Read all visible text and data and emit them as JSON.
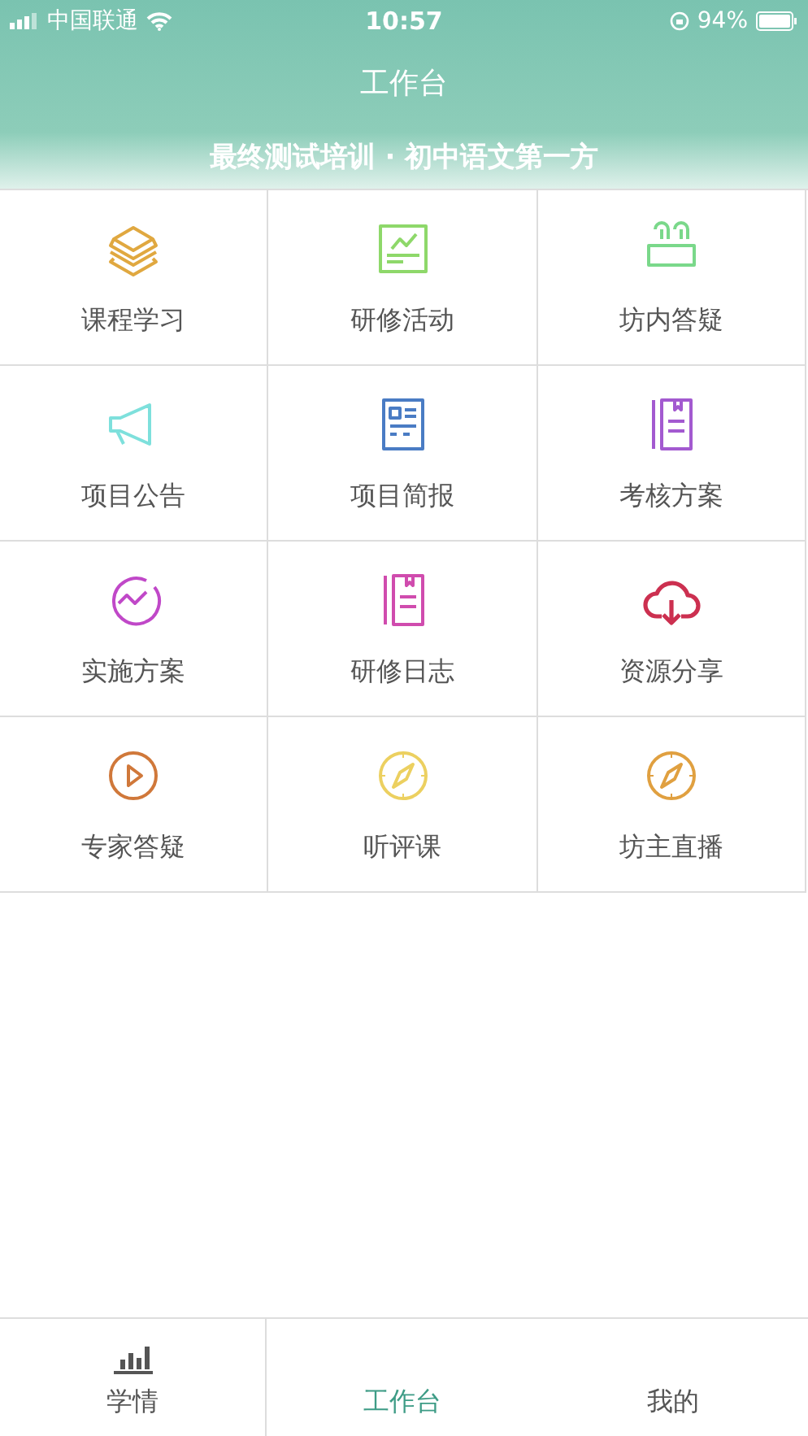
{
  "status_bar": {
    "carrier": "中国联通",
    "time": "10:57",
    "battery": "94%"
  },
  "nav": {
    "title": "工作台"
  },
  "banner": {
    "title": "最终测试培训 · 初中语文第一方"
  },
  "grid": [
    {
      "label": "课程学习",
      "kind": "boxes",
      "color": "#e0a840"
    },
    {
      "label": "研修活动",
      "kind": "chart",
      "color": "#8ed86a"
    },
    {
      "label": "坊内答疑",
      "kind": "people",
      "color": "#7ad88a"
    },
    {
      "label": "项目公告",
      "kind": "megaphone",
      "color": "#7ee0dc"
    },
    {
      "label": "项目简报",
      "kind": "newspaper",
      "color": "#4a7cc4"
    },
    {
      "label": "考核方案",
      "kind": "notebook",
      "color": "#a35ad0"
    },
    {
      "label": "实施方案",
      "kind": "trend",
      "color": "#c048c8"
    },
    {
      "label": "研修日志",
      "kind": "notebook",
      "color": "#d04cae"
    },
    {
      "label": "资源分享",
      "kind": "cloud",
      "color": "#cc3050"
    },
    {
      "label": "专家答疑",
      "kind": "play",
      "color": "#d0783a"
    },
    {
      "label": "听评课",
      "kind": "compass",
      "color": "#ecd060"
    },
    {
      "label": "坊主直播",
      "kind": "compass",
      "color": "#e0a040"
    }
  ],
  "tab_bar": [
    {
      "label": "学情",
      "selected": false
    },
    {
      "label": "工作台",
      "selected": true
    },
    {
      "label": "我的",
      "selected": false
    }
  ]
}
